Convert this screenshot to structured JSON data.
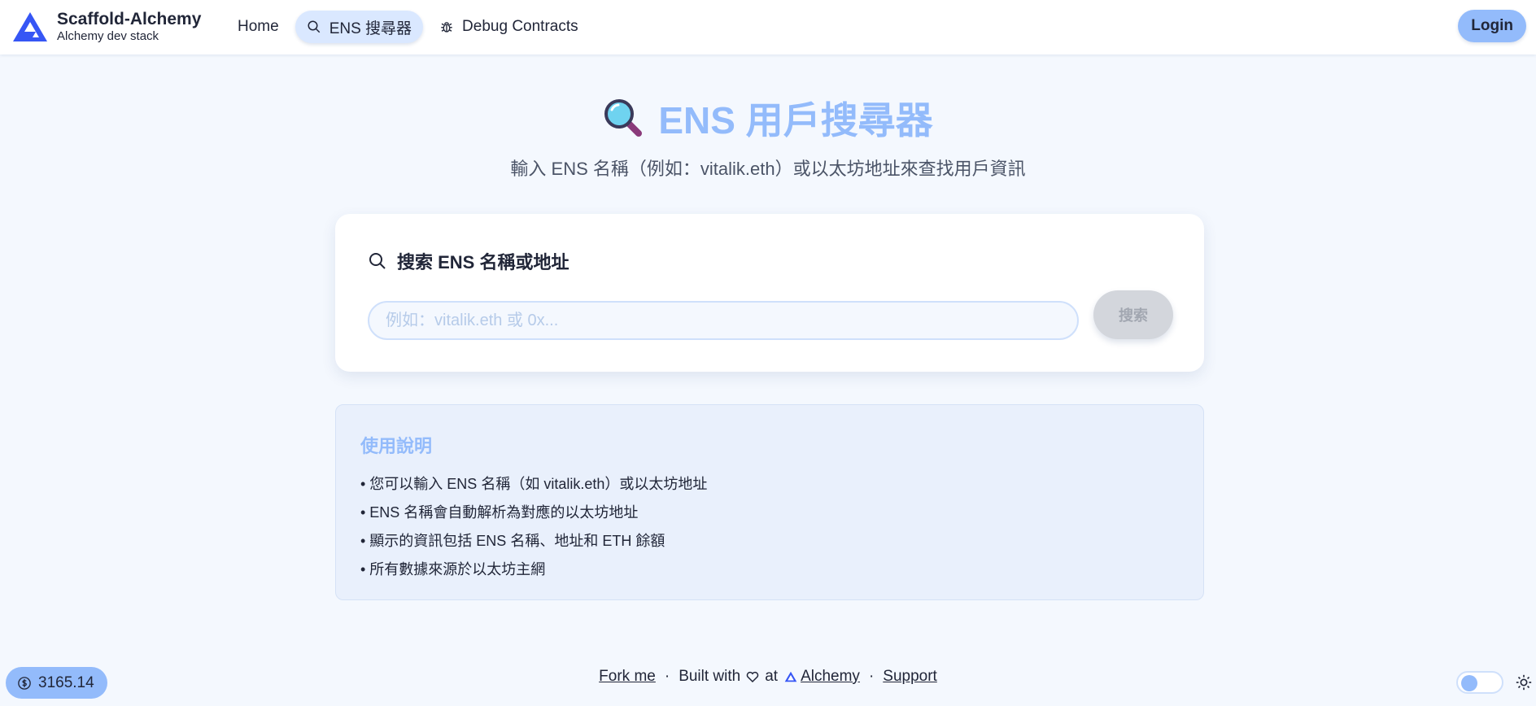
{
  "header": {
    "brand_title": "Scaffold-Alchemy",
    "brand_subtitle": "Alchemy dev stack",
    "nav": [
      {
        "label": "Home",
        "icon": "none",
        "active": false
      },
      {
        "label": "ENS 搜尋器",
        "icon": "search-icon",
        "active": true
      },
      {
        "label": "Debug Contracts",
        "icon": "bug-icon",
        "active": false
      }
    ],
    "login_label": "Login"
  },
  "hero": {
    "title": "ENS 用戶搜尋器",
    "subtitle": "輸入 ENS 名稱（例如：vitalik.eth）或以太坊地址來查找用戶資訊"
  },
  "search_card": {
    "title": "搜索 ENS 名稱或地址",
    "input_placeholder": "例如：vitalik.eth 或 0x...",
    "input_value": "",
    "button_label": "搜索"
  },
  "instructions": {
    "title": "使用說明",
    "items": [
      "• 您可以輸入 ENS 名稱（如 vitalik.eth）或以太坊地址",
      "• ENS 名稱會自動解析為對應的以太坊地址",
      "• 顯示的資訊包括 ENS 名稱、地址和 ETH 餘額",
      "• 所有數據來源於以太坊主網"
    ]
  },
  "footer": {
    "price": "3165.14",
    "fork_label": "Fork me",
    "built_with": "Built with",
    "at": "at",
    "alchemy_label": "Alchemy",
    "support_label": "Support"
  },
  "colors": {
    "accent": "#93bbfb",
    "background": "#f4f8fe",
    "text": "#212638",
    "brand_blue": "#3656f5"
  }
}
